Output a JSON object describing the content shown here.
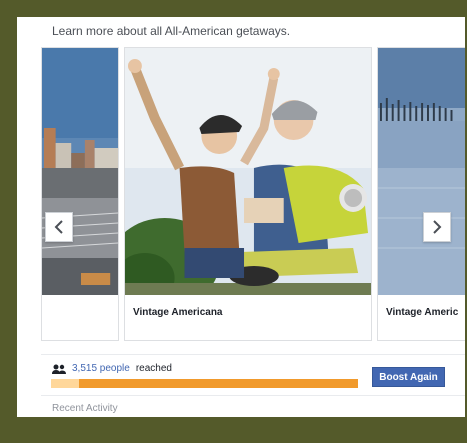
{
  "intro_text": "Learn more about all All-American getaways.",
  "slides": [
    {
      "caption": "",
      "image": "city-skyline-photo"
    },
    {
      "caption": "Vintage Americana",
      "image": "couple-on-scooter-photo"
    },
    {
      "caption": "Vintage Americ",
      "image": "lake-with-pier-photo"
    }
  ],
  "nav": {
    "prev_icon": "chevron-left-icon",
    "next_icon": "chevron-right-icon"
  },
  "reach": {
    "count_text": "3,515 people",
    "suffix": "reached",
    "progress_fraction": 0.09
  },
  "boost_label": "Boost Again",
  "recent_label": "Recent Activity",
  "colors": {
    "accent": "#4267b2",
    "progress": "#f19a2c",
    "progress_fill": "#ffd79a",
    "background": "#545a2a"
  }
}
